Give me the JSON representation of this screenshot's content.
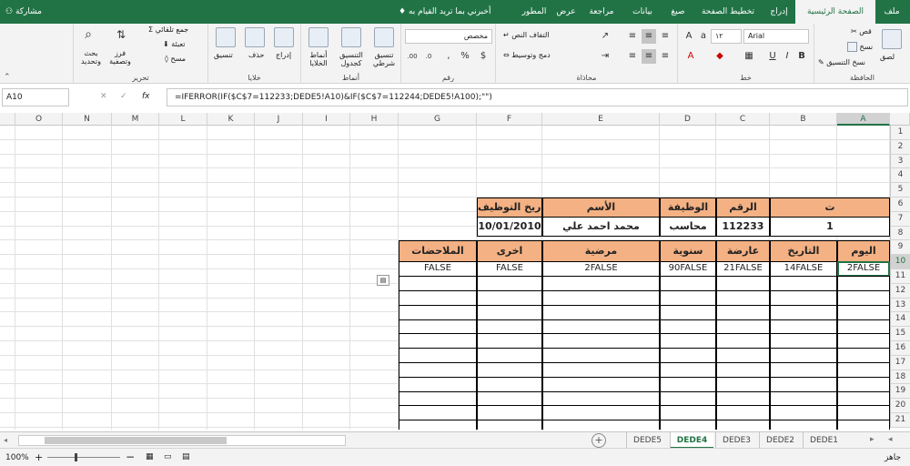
{
  "top": {
    "share": "مشاركة",
    "tell_me": "أخبرني بما تريد القيام به",
    "tabs": [
      "ملف",
      "الصفحة الرئيسية",
      "إدراج",
      "تخطيط الصفحة",
      "صيغ",
      "بيانات",
      "مراجعة",
      "عرض",
      "المطور"
    ]
  },
  "ribbon": {
    "clipboard": {
      "paste": "لصق",
      "cut": "قص",
      "copy": "نسخ",
      "format_painter": "نسخ التنسيق",
      "label": "الحافظة"
    },
    "font": {
      "name": "Arial",
      "size": "١٢",
      "bold": "B",
      "italic": "I",
      "underline": "U",
      "label": "خط"
    },
    "alignment": {
      "wrap": "التفاف النص",
      "merge": "دمج وتوسيط",
      "label": "محاذاة"
    },
    "number": {
      "format": "مخصص",
      "label": "رقم"
    },
    "styles": {
      "conditional": "تنسيق شرطي",
      "table": "التنسيق كجدول",
      "cell": "أنماط الخلايا",
      "label": "أنماط"
    },
    "cells": {
      "insert": "إدراج",
      "delete": "حذف",
      "format": "تنسيق",
      "label": "خلايا"
    },
    "editing": {
      "autosum": "جمع تلقائي",
      "fill": "تعبئة",
      "clear": "مسح",
      "sort": "فرز وتصفية",
      "find": "بحث وتحديد",
      "label": "تحرير"
    }
  },
  "formula_bar": {
    "name_box": "A10",
    "cancel": "✕",
    "enter": "✓",
    "fx": "fx",
    "formula": "=IFERROR(IF($C$7=112233;DEDE5!A10)&IF($C$7=112244;DEDE5!A100);\"\")"
  },
  "columns": [
    "O",
    "N",
    "M",
    "L",
    "K",
    "J",
    "I",
    "H",
    "G",
    "F",
    "E",
    "D",
    "C",
    "B",
    "A"
  ],
  "rows": [
    "1",
    "2",
    "3",
    "4",
    "5",
    "6",
    "7",
    "8",
    "9",
    "10",
    "11",
    "12",
    "13",
    "14",
    "15",
    "16",
    "17",
    "18",
    "19",
    "20",
    "21"
  ],
  "info_table": {
    "headers": [
      "ت",
      "الرقم",
      "الوظيفة",
      "الأسم",
      "تاريخ التوظيف"
    ],
    "values": [
      "1",
      "112233",
      "محاسب",
      "محمد احمد علي",
      "10/01/2010"
    ]
  },
  "main_table": {
    "headers": [
      "اليوم",
      "التاريخ",
      "عارضة",
      "سنوية",
      "مرضية",
      "اخرى",
      "الملاحضات"
    ],
    "row10": [
      "2FALSE",
      "14FALSE",
      "21FALSE",
      "90FALSE",
      "2FALSE",
      "FALSE",
      "FALSE"
    ]
  },
  "sheets": [
    "DEDE5",
    "DEDE4",
    "DEDE3",
    "DEDE2",
    "DEDE1"
  ],
  "active_sheet": "DEDE4",
  "status": {
    "ready": "جاهز",
    "zoom": "100%"
  },
  "colors": {
    "excel_green": "#217346",
    "header_fill": "#f4b183"
  }
}
